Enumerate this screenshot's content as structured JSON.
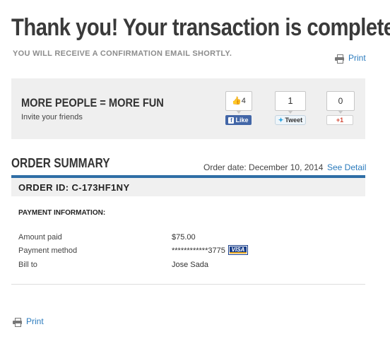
{
  "header": {
    "title": "Thank you! Your transaction is complete.",
    "subtitle": "YOU WILL RECEIVE A CONFIRMATION EMAIL SHORTLY.",
    "print_label": "Print"
  },
  "share": {
    "title": "MORE PEOPLE = MORE FUN",
    "subtitle": "Invite your friends",
    "facebook": {
      "count": "4",
      "label": "Like",
      "icon": "thumbs-up-icon"
    },
    "twitter": {
      "count": "1",
      "label": "Tweet",
      "icon": "twitter-bird-icon"
    },
    "google": {
      "count": "0",
      "label": "+1"
    }
  },
  "order": {
    "title": "ORDER SUMMARY",
    "date_text": "Order date: December 10, 2014",
    "see_detail": "See Detail",
    "id_text": "ORDER ID: C-173HF1NY"
  },
  "payment": {
    "heading": "PAYMENT INFORMATION:",
    "rows": [
      {
        "label": "Amount paid",
        "value": "$75.00"
      },
      {
        "label": "Payment method",
        "value": "************3775"
      },
      {
        "label": "Bill to",
        "value": "Jose Sada"
      }
    ],
    "card_brand": "VISA"
  },
  "footer": {
    "print_label": "Print"
  },
  "colors": {
    "link": "#2b7bbd",
    "accent_rule": "#2f6ea6",
    "facebook": "#4266a7"
  }
}
